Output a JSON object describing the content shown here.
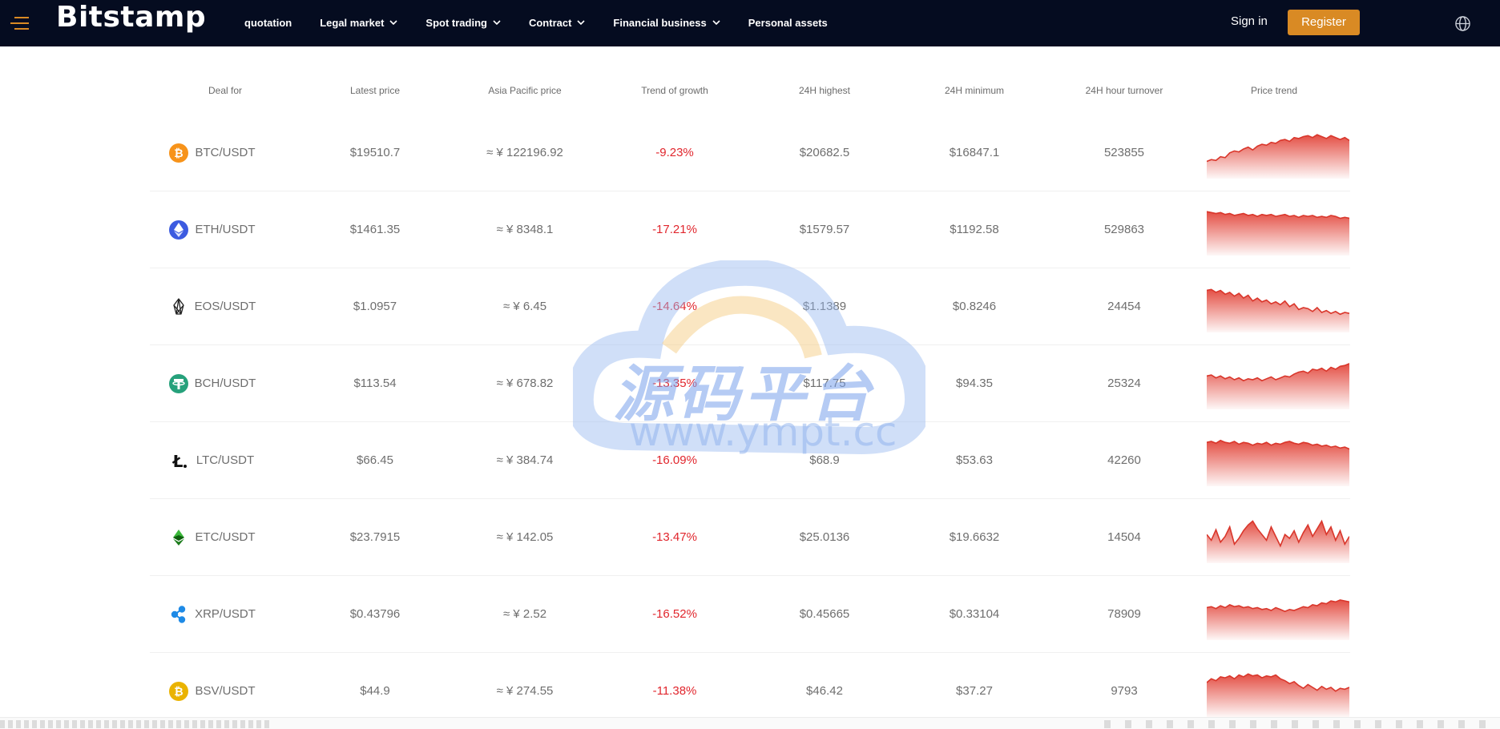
{
  "header": {
    "logo": "Bitstamp",
    "nav": [
      {
        "label": "quotation",
        "dropdown": false
      },
      {
        "label": "Legal market",
        "dropdown": true
      },
      {
        "label": "Spot trading",
        "dropdown": true
      },
      {
        "label": "Contract",
        "dropdown": true
      },
      {
        "label": "Financial business",
        "dropdown": true
      },
      {
        "label": "Personal assets",
        "dropdown": false
      }
    ],
    "signin_label": "Sign in",
    "register_label": "Register",
    "accent_color": "#d98a24",
    "bg_color": "#050c20"
  },
  "table": {
    "columns": [
      "Deal for",
      "Latest price",
      "Asia Pacific price",
      "Trend of growth",
      "24H highest",
      "24H minimum",
      "24H hour turnover",
      "Price trend"
    ],
    "rows": [
      {
        "icon": "bitcoin-icon",
        "pair": "BTC/USDT",
        "latest": "$19510.7",
        "asia": "≈ ¥ 122196.92",
        "growth": "-9.23%",
        "high": "$20682.5",
        "low": "$16847.1",
        "turnover": "523855",
        "trend": [
          18,
          20,
          19,
          23,
          22,
          27,
          29,
          28,
          31,
          33,
          30,
          34,
          36,
          35,
          38,
          37,
          40,
          41,
          39,
          43,
          42,
          44,
          45,
          43,
          46,
          44,
          42,
          45,
          43,
          41,
          43,
          40
        ]
      },
      {
        "icon": "ethereum-icon",
        "pair": "ETH/USDT",
        "latest": "$1461.35",
        "asia": "≈ ¥ 8348.1",
        "growth": "-17.21%",
        "high": "$1579.57",
        "low": "$1192.58",
        "turnover": "529863",
        "trend": [
          46,
          45,
          44,
          45,
          43,
          44,
          42,
          43,
          44,
          42,
          43,
          41,
          43,
          42,
          43,
          41,
          42,
          43,
          41,
          42,
          40,
          42,
          41,
          42,
          40,
          41,
          40,
          42,
          41,
          39,
          40,
          39
        ]
      },
      {
        "icon": "eos-icon",
        "pair": "EOS/USDT",
        "latest": "$1.0957",
        "asia": "≈ ¥ 6.45",
        "growth": "-14.64%",
        "high": "$1.1389",
        "low": "$0.8246",
        "turnover": "24454",
        "trend": [
          44,
          45,
          42,
          44,
          40,
          42,
          38,
          41,
          36,
          39,
          33,
          36,
          32,
          34,
          30,
          32,
          29,
          33,
          27,
          30,
          24,
          26,
          25,
          22,
          26,
          21,
          23,
          20,
          22,
          19,
          21,
          20
        ]
      },
      {
        "icon": "tether-icon",
        "pair": "BCH/USDT",
        "latest": "$113.54",
        "asia": "≈ ¥ 678.82",
        "growth": "-13.35%",
        "high": "$117.75",
        "low": "$94.35",
        "turnover": "25324",
        "trend": [
          35,
          36,
          33,
          35,
          32,
          34,
          31,
          33,
          30,
          32,
          31,
          33,
          30,
          32,
          34,
          31,
          33,
          35,
          34,
          37,
          39,
          40,
          38,
          42,
          41,
          43,
          40,
          44,
          42,
          45,
          46,
          48
        ]
      },
      {
        "icon": "litecoin-icon",
        "pair": "LTC/USDT",
        "latest": "$66.45",
        "asia": "≈ ¥ 384.74",
        "growth": "-16.09%",
        "high": "$68.9",
        "low": "$53.63",
        "turnover": "42260",
        "trend": [
          46,
          47,
          45,
          48,
          46,
          45,
          47,
          44,
          46,
          45,
          43,
          45,
          44,
          46,
          43,
          45,
          44,
          46,
          47,
          45,
          44,
          46,
          45,
          43,
          44,
          42,
          43,
          41,
          42,
          40,
          41,
          39
        ]
      },
      {
        "icon": "etc-icon",
        "pair": "ETC/USDT",
        "latest": "$23.7915",
        "asia": "≈ ¥ 142.05",
        "growth": "-13.47%",
        "high": "$25.0136",
        "low": "$19.6632",
        "turnover": "14504",
        "trend": [
          30,
          24,
          35,
          22,
          28,
          38,
          20,
          26,
          34,
          40,
          44,
          36,
          30,
          24,
          38,
          28,
          18,
          30,
          26,
          34,
          22,
          32,
          40,
          28,
          36,
          44,
          30,
          38,
          24,
          34,
          20,
          28
        ]
      },
      {
        "icon": "xrp-icon",
        "pair": "XRP/USDT",
        "latest": "$0.43796",
        "asia": "≈ ¥ 2.52",
        "growth": "-16.52%",
        "high": "$0.45665",
        "low": "$0.33104",
        "turnover": "78909",
        "trend": [
          34,
          35,
          33,
          36,
          34,
          37,
          35,
          36,
          34,
          35,
          33,
          34,
          32,
          33,
          31,
          34,
          32,
          30,
          32,
          31,
          33,
          35,
          34,
          37,
          36,
          39,
          38,
          41,
          40,
          42,
          41,
          40
        ]
      },
      {
        "icon": "bitcoin-sv-icon",
        "pair": "BSV/USDT",
        "latest": "$44.9",
        "asia": "≈ ¥ 274.55",
        "growth": "-11.38%",
        "high": "$46.42",
        "low": "$37.27",
        "turnover": "9793",
        "trend": [
          36,
          40,
          38,
          42,
          41,
          43,
          40,
          44,
          42,
          45,
          43,
          44,
          41,
          43,
          42,
          44,
          40,
          38,
          35,
          37,
          33,
          30,
          34,
          31,
          28,
          32,
          29,
          31,
          27,
          30,
          29,
          31
        ]
      }
    ]
  },
  "watermark": {
    "title": "源码平台",
    "url": "www.ympt.cc"
  }
}
